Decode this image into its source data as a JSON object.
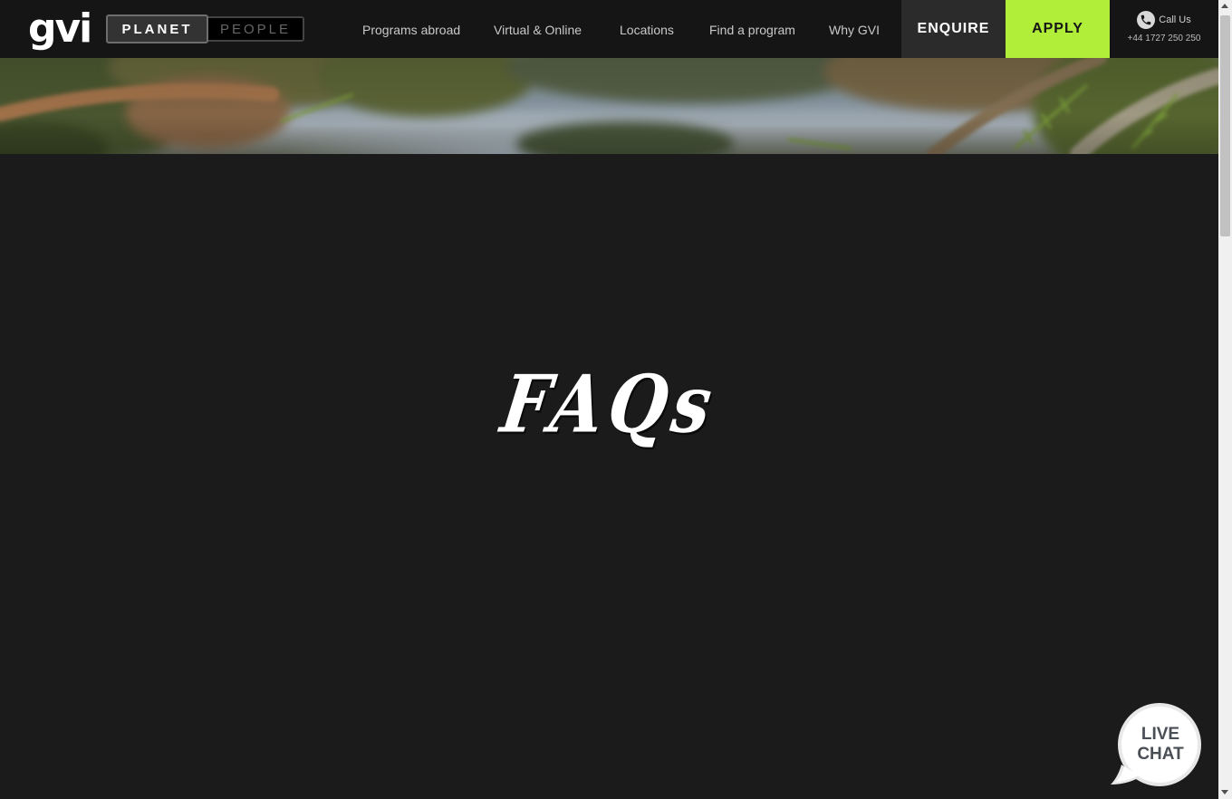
{
  "header": {
    "logo": "gvi",
    "toggle": {
      "planet": "PLANET",
      "people": "PEOPLE",
      "active": "planet"
    },
    "nav": [
      {
        "label": "Programs abroad"
      },
      {
        "label": "Virtual & Online"
      },
      {
        "label": "Locations"
      },
      {
        "label": "Find a program"
      },
      {
        "label": "Why GVI"
      }
    ],
    "enquire_label": "ENQUIRE",
    "apply_label": "APPLY",
    "call": {
      "label": "Call Us",
      "number": "+44 1727 250 250"
    }
  },
  "hero": {
    "image": "jungle-canopy-banner"
  },
  "main": {
    "title": "FAQs"
  },
  "live_chat": {
    "line1": "LIVE",
    "line2": "CHAT"
  },
  "colors": {
    "header_bg": "#151515",
    "page_bg": "#1b1b1c",
    "enquire_bg": "#2b2b2b",
    "apply_bg": "#b1ee3a",
    "nav_text": "#c9c9c9"
  },
  "icons": [
    "phone-icon",
    "chat-bubble-icon"
  ]
}
